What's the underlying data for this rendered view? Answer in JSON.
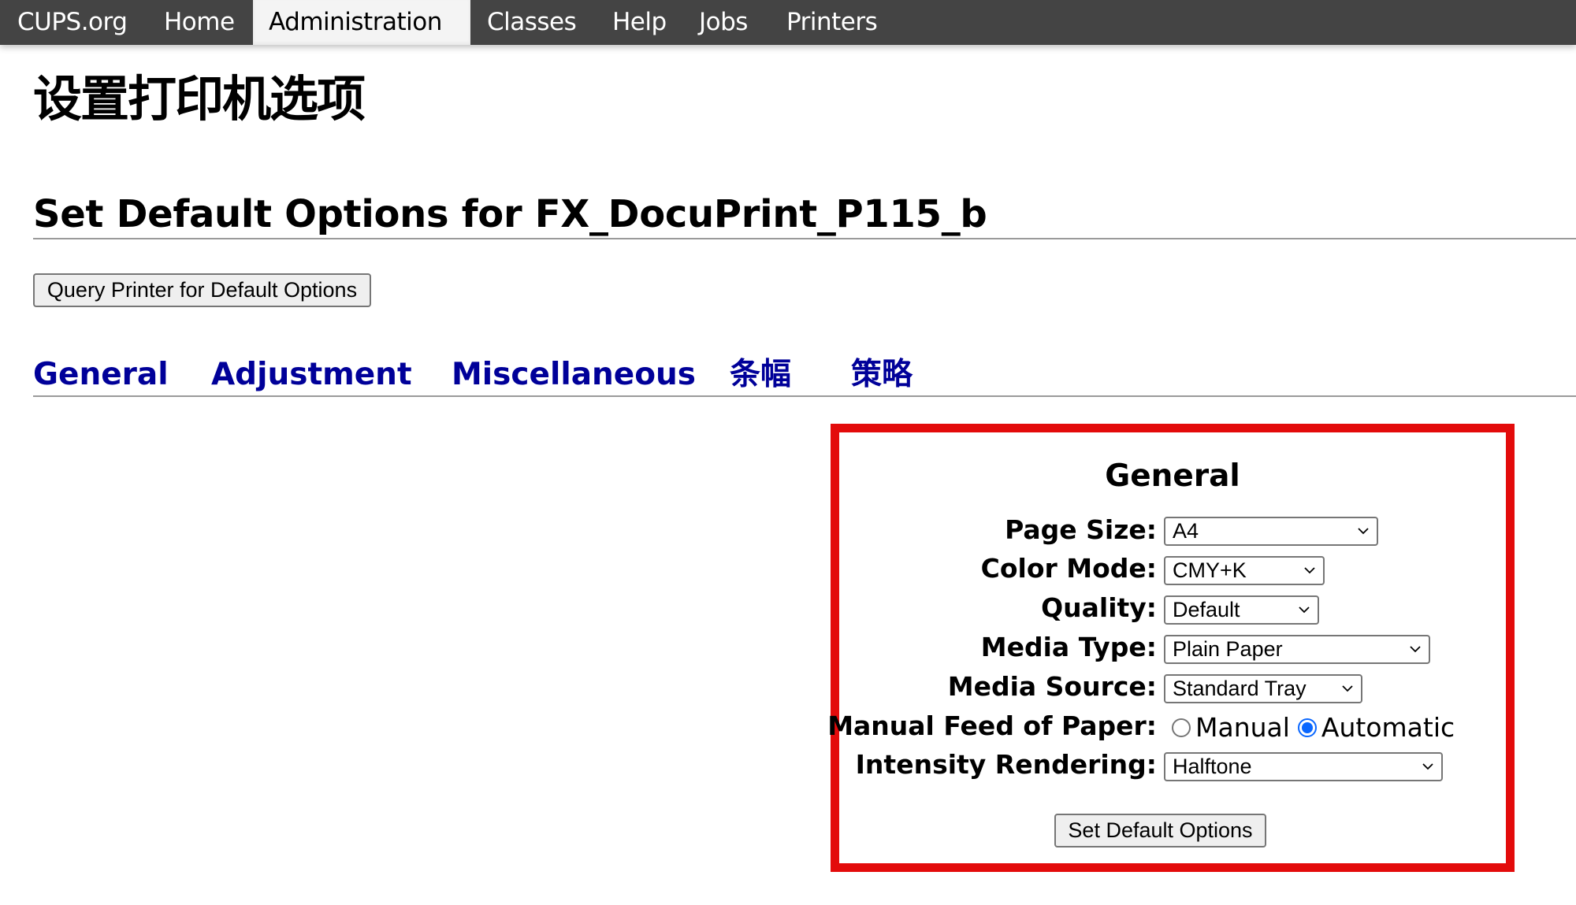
{
  "nav": {
    "items": [
      {
        "label": "CUPS.org",
        "active": false
      },
      {
        "label": "Home",
        "active": false
      },
      {
        "label": "Administration",
        "active": true
      },
      {
        "label": "Classes",
        "active": false
      },
      {
        "label": "Help",
        "active": false
      },
      {
        "label": "Jobs",
        "active": false
      },
      {
        "label": "Printers",
        "active": false
      }
    ]
  },
  "page": {
    "title_cn": "设置打印机选项",
    "title_en": "Set Default Options for FX_DocuPrint_P115_b",
    "query_button": "Query Printer for Default Options"
  },
  "tabs": [
    {
      "label": "General"
    },
    {
      "label": "Adjustment"
    },
    {
      "label": "Miscellaneous"
    },
    {
      "label": "条幅"
    },
    {
      "label": "策略"
    }
  ],
  "panel": {
    "title": "General",
    "highlight_color": "#e30b0b",
    "fields": [
      {
        "label": "Page Size:",
        "type": "select",
        "value": "A4"
      },
      {
        "label": "Color Mode:",
        "type": "select",
        "value": "CMY+K"
      },
      {
        "label": "Quality:",
        "type": "select",
        "value": "Default"
      },
      {
        "label": "Media Type:",
        "type": "select",
        "value": "Plain Paper"
      },
      {
        "label": "Media Source:",
        "type": "select",
        "value": "Standard Tray"
      },
      {
        "label": "Manual Feed of Paper:",
        "type": "radio",
        "options": [
          {
            "label": "Manual",
            "checked": false
          },
          {
            "label": "Automatic",
            "checked": true
          }
        ]
      },
      {
        "label": "Intensity Rendering:",
        "type": "select",
        "value": "Halftone"
      }
    ],
    "submit_button": "Set Default Options"
  }
}
